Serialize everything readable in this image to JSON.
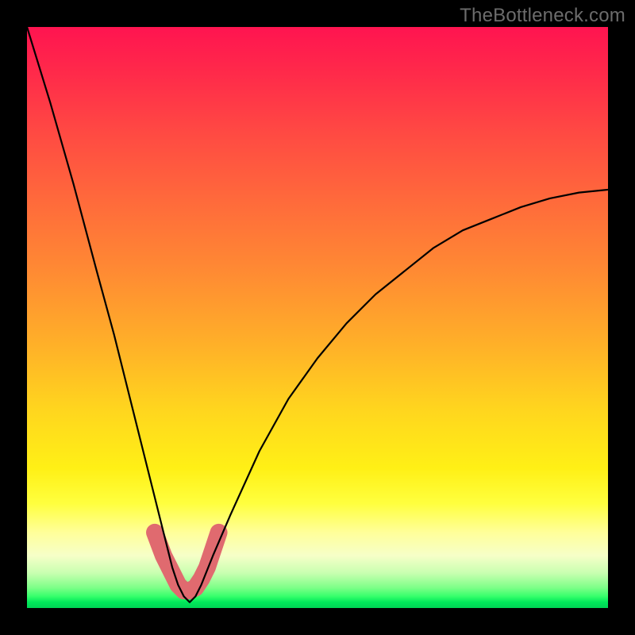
{
  "watermark": "TheBottleneck.com",
  "colors": {
    "frame": "#000000",
    "curve": "#000000",
    "highlight": "#e06a6f"
  },
  "chart_data": {
    "type": "line",
    "title": "",
    "xlabel": "",
    "ylabel": "",
    "xlim": [
      0,
      100
    ],
    "ylim": [
      0,
      100
    ],
    "grid": false,
    "series": [
      {
        "name": "bottleneck-curve",
        "x": [
          0,
          4,
          8,
          12,
          15,
          18,
          20,
          22,
          24,
          25,
          26,
          27,
          28,
          29,
          30,
          32,
          35,
          40,
          45,
          50,
          55,
          60,
          65,
          70,
          75,
          80,
          85,
          90,
          95,
          100
        ],
        "values": [
          100,
          87,
          73,
          58,
          47,
          35,
          27,
          19,
          11,
          7,
          4,
          2,
          1,
          2,
          4,
          9,
          16,
          27,
          36,
          43,
          49,
          54,
          58,
          62,
          65,
          67,
          69,
          70.5,
          71.5,
          72
        ]
      }
    ],
    "highlight_region": {
      "name": "bottom-u",
      "x": [
        22,
        23.5,
        25,
        26,
        27,
        28,
        29,
        30,
        31,
        32,
        33
      ],
      "values": [
        13,
        9,
        6,
        4,
        3,
        3,
        3.5,
        5,
        7,
        10,
        13
      ]
    },
    "background_gradient_stops": [
      {
        "pos": 0.0,
        "color": "#ff1450"
      },
      {
        "pos": 0.3,
        "color": "#ff6a3b"
      },
      {
        "pos": 0.66,
        "color": "#ffd61e"
      },
      {
        "pos": 0.86,
        "color": "#ffff9a"
      },
      {
        "pos": 1.0,
        "color": "#00d455"
      }
    ]
  }
}
